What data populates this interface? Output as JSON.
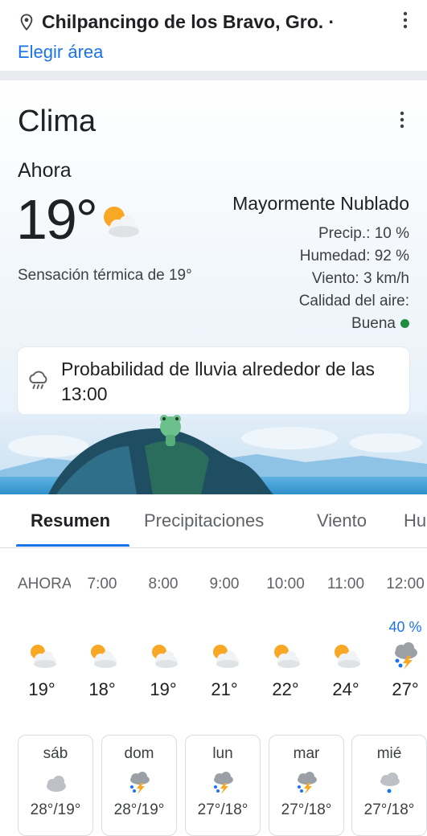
{
  "location": {
    "name": "Chilpancingo de los Bravo, Gro. ·",
    "choose_area": "Elegir área"
  },
  "weather": {
    "title": "Clima",
    "now_label": "Ahora",
    "temp": "19°",
    "feels_like": "Sensación térmica de 19°",
    "condition": "Mayormente Nublado",
    "precip": "Precip.: 10 %",
    "humidity": "Humedad: 92 %",
    "wind": "Viento: 3 km/h",
    "air_quality_label": "Calidad del aire:",
    "air_quality_value": "Buena",
    "air_quality_color": "#1e8e3e",
    "alert": "Probabilidad de lluvia alrededor de las 13:00",
    "now_icon": "partly-cloudy-icon"
  },
  "tabs": [
    "Resumen",
    "Precipitaciones",
    "Viento",
    "Hu"
  ],
  "hourly": [
    {
      "time": "AHORA",
      "precip": "",
      "temp": "19°",
      "icon": "partly-cloudy-icon"
    },
    {
      "time": "7:00",
      "precip": "",
      "temp": "18°",
      "icon": "partly-cloudy-icon"
    },
    {
      "time": "8:00",
      "precip": "",
      "temp": "19°",
      "icon": "partly-cloudy-icon"
    },
    {
      "time": "9:00",
      "precip": "",
      "temp": "21°",
      "icon": "partly-cloudy-icon"
    },
    {
      "time": "10:00",
      "precip": "",
      "temp": "22°",
      "icon": "partly-cloudy-icon"
    },
    {
      "time": "11:00",
      "precip": "",
      "temp": "24°",
      "icon": "partly-cloudy-icon"
    },
    {
      "time": "12:00",
      "precip": "40 %",
      "temp": "27°",
      "icon": "thunderstorm-icon"
    }
  ],
  "daily": [
    {
      "day": "sáb",
      "range": "28°/19°",
      "icon": "cloudy-icon"
    },
    {
      "day": "dom",
      "range": "28°/19°",
      "icon": "thunderstorm-icon"
    },
    {
      "day": "lun",
      "range": "27°/18°",
      "icon": "thunderstorm-icon"
    },
    {
      "day": "mar",
      "range": "27°/18°",
      "icon": "thunderstorm-icon"
    },
    {
      "day": "mié",
      "range": "27°/18°",
      "icon": "rain-icon"
    }
  ],
  "colors": {
    "accent": "#1a73e8",
    "text": "#202124"
  }
}
